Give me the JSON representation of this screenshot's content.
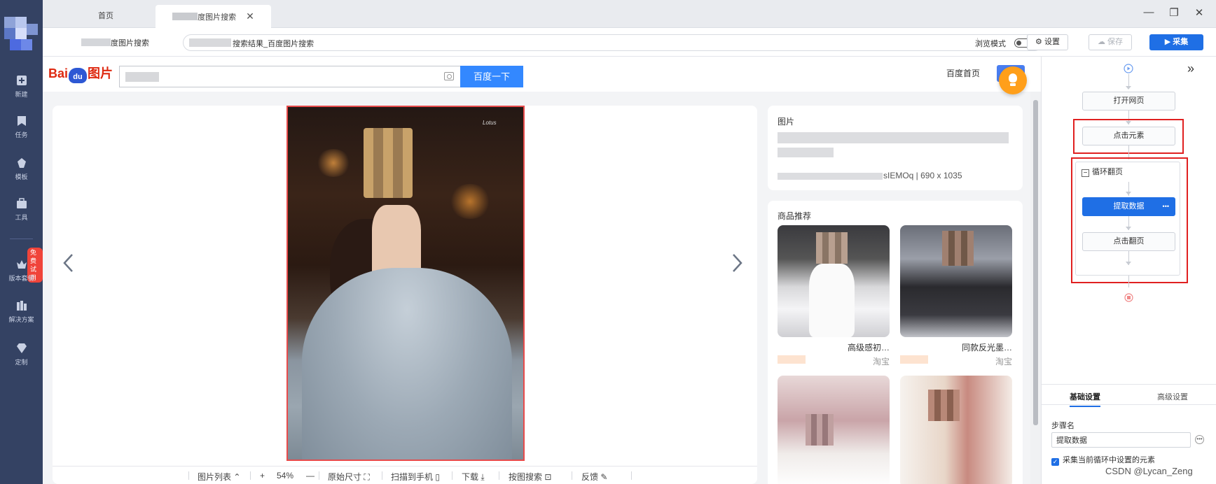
{
  "sidebar": {
    "items": [
      {
        "label": "新建",
        "icon": "plus-square-icon"
      },
      {
        "label": "任务",
        "icon": "bookmark-icon"
      },
      {
        "label": "模板",
        "icon": "puzzle-icon"
      },
      {
        "label": "工具",
        "icon": "toolbox-icon"
      },
      {
        "label": "版本套餐",
        "icon": "crown-icon"
      },
      {
        "label": "解决方案",
        "icon": "columns-icon"
      },
      {
        "label": "定制",
        "icon": "diamond-icon"
      }
    ],
    "badge": "免费试用"
  },
  "tabs": [
    {
      "label": "首页"
    },
    {
      "label": "度图片搜索",
      "close": "✕"
    }
  ],
  "window": {
    "minimize": "—",
    "restore": "❐",
    "close": "✕"
  },
  "address": {
    "title": "度图片搜索",
    "url": "搜索结果_百度图片搜索",
    "mode_label": "浏览模式",
    "settings": "设置",
    "save": "保存",
    "collect": "采集"
  },
  "baidu": {
    "logo_bai": "Bai",
    "logo_du": "du",
    "logo_pic": "图片",
    "search_button": "百度一下",
    "home_link": "百度首页"
  },
  "viewer": {
    "photo_tag": "Lotus",
    "toolbar": [
      {
        "label": "图片列表"
      },
      {
        "label": "+"
      },
      {
        "label": "54%"
      },
      {
        "label": "—"
      },
      {
        "label": "原始尺寸"
      },
      {
        "label": "扫描到手机"
      },
      {
        "label": "下载"
      },
      {
        "label": "按图搜索"
      },
      {
        "label": "反馈"
      }
    ]
  },
  "info_card": {
    "label": "图片",
    "meta": "sIEMOq | 690 x 1035"
  },
  "products": {
    "title": "商品推荐",
    "items": [
      {
        "name": "高级感初…",
        "source": "淘宝"
      },
      {
        "name": "同款反光墨…",
        "source": "淘宝"
      }
    ]
  },
  "workflow": {
    "nodes": {
      "open_page": "打开网页",
      "click_element": "点击元素",
      "loop_label": "循环翻页",
      "extract": "提取数据",
      "extract_more": "•••",
      "click_next": "点击翻页"
    },
    "collapse": "»",
    "tabs": {
      "basic": "基础设置",
      "advanced": "高级设置"
    },
    "step_name_label": "步骤名",
    "step_name_value": "提取数据",
    "checkbox_label": "采集当前循环中设置的元素"
  },
  "watermark": "CSDN @Lycan_Zeng",
  "colors": {
    "sidebar": "#344263",
    "primary": "#1f6fe5",
    "baidu_blue": "#3388ff",
    "highlight_red": "#e02020"
  }
}
